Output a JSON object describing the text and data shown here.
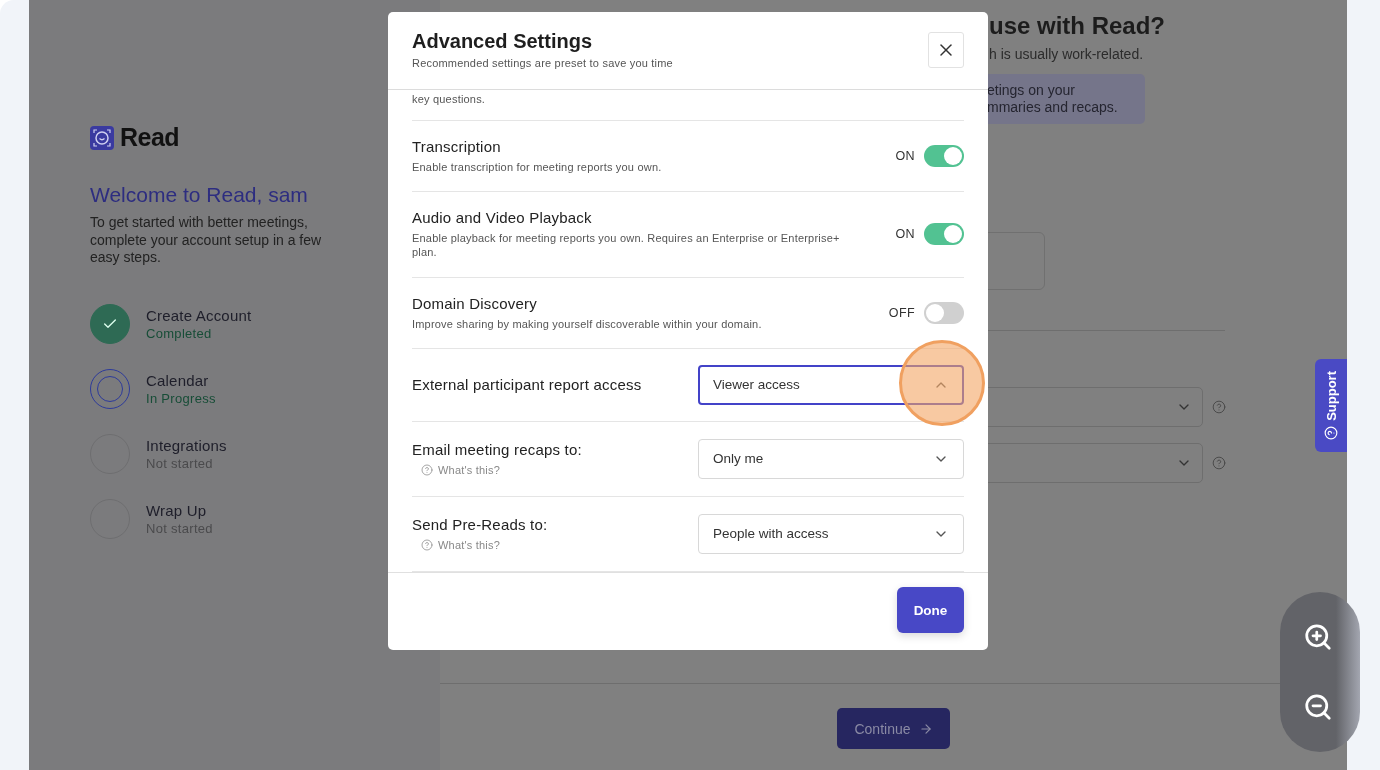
{
  "sidebar": {
    "logo_text": "Read",
    "heading": "Welcome to Read, sam",
    "intro": "To get started with better meetings, complete your account setup in a few easy steps.",
    "steps": [
      {
        "title": "Create Account",
        "status_text": "Completed",
        "kind": "completed"
      },
      {
        "title": "Calendar",
        "status_text": "In Progress",
        "kind": "in_progress"
      },
      {
        "title": "Integrations",
        "status_text": "Not started",
        "kind": "not_started"
      },
      {
        "title": "Wrap Up",
        "status_text": "Not started",
        "kind": "not_started"
      }
    ]
  },
  "background": {
    "heading": "use with Read?",
    "subheading": "h is usually work-related.",
    "note_lines": [
      "etings on your",
      "mmaries and recaps."
    ],
    "continue_button": "Continue"
  },
  "support_tab": {
    "label": "Support"
  },
  "modal": {
    "title": "Advanced Settings",
    "subtitle": "Recommended settings are preset to save you time",
    "cut_text": "key questions.",
    "toggles": [
      {
        "title": "Transcription",
        "description": "Enable transcription for meeting reports you own.",
        "state_text": "ON",
        "on": true
      },
      {
        "title": "Audio and Video Playback",
        "description": "Enable playback for meeting reports you own. Requires an Enterprise or Enterprise+ plan.",
        "state_text": "ON",
        "on": true
      },
      {
        "title": "Domain Discovery",
        "description": "Improve sharing by making yourself discoverable within your domain.",
        "state_text": "OFF",
        "on": false
      }
    ],
    "selects": [
      {
        "label": "External participant report access",
        "value": "Viewer access",
        "expanded": true
      },
      {
        "label": "Email meeting recaps to:",
        "help": "What's this?",
        "value": "Only me",
        "expanded": false
      },
      {
        "label": "Send Pre-Reads to:",
        "help": "What's this?",
        "value": "People with access",
        "expanded": false
      }
    ],
    "done_button": "Done"
  }
}
